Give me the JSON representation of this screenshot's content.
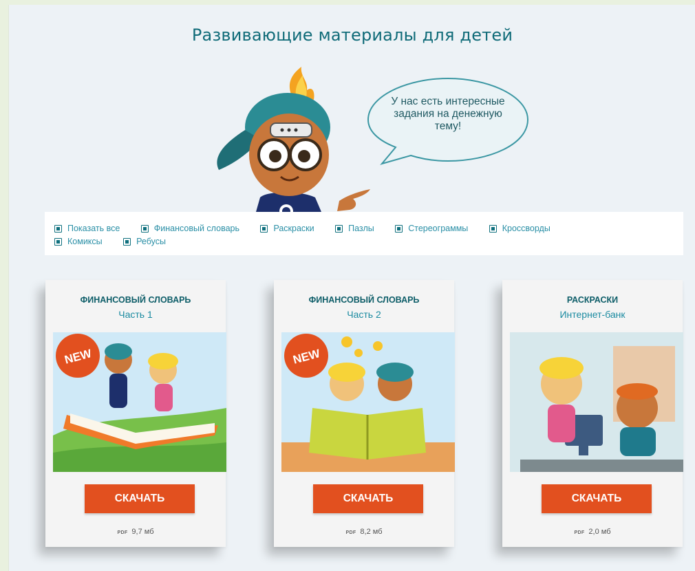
{
  "page": {
    "title": "Развивающие материалы для детей"
  },
  "mascot": {
    "speech": "У нас есть интересные задания на денежную тему!"
  },
  "filters": [
    "Показать все",
    "Финансовый словарь",
    "Раскраски",
    "Пазлы",
    "Стереограммы",
    "Кроссворды",
    "Комиксы",
    "Ребусы"
  ],
  "cards": [
    {
      "category": "ФИНАНСОВЫЙ СЛОВАРЬ",
      "subtitle": "Часть 1",
      "badge": "NEW",
      "button": "СКАЧАТЬ",
      "file_type": "PDF",
      "file_size": "9,7 мб"
    },
    {
      "category": "ФИНАНСОВЫЙ СЛОВАРЬ",
      "subtitle": "Часть 2",
      "badge": "NEW",
      "button": "СКАЧАТЬ",
      "file_type": "PDF",
      "file_size": "8,2 мб"
    },
    {
      "category": "РАСКРАСКИ",
      "subtitle": "Интернет-банк",
      "badge": "",
      "button": "СКАЧАТЬ",
      "file_type": "PDF",
      "file_size": "2,0 мб"
    }
  ],
  "colors": {
    "accent": "#e2501f",
    "title": "#0f6b78",
    "link": "#2a8fa6"
  }
}
